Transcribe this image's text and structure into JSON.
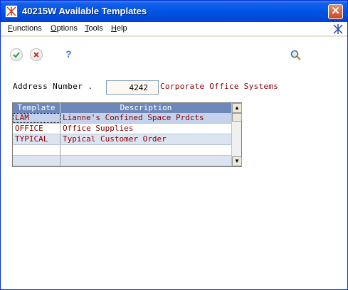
{
  "window": {
    "title": "40215W  Available Templates",
    "close_glyph": "✕"
  },
  "menu": {
    "items": [
      {
        "mnemonic": "F",
        "rest": "unctions"
      },
      {
        "mnemonic": "O",
        "rest": "ptions"
      },
      {
        "mnemonic": "T",
        "rest": "ools"
      },
      {
        "mnemonic": "H",
        "rest": "elp"
      }
    ]
  },
  "toolbar": {
    "ok_icon": "checkmark-icon",
    "cancel_icon": "cancel-icon",
    "help_label": "?",
    "find_icon": "magnifier-icon",
    "accent_ok": "#2a9a2a",
    "accent_cancel": "#d03020"
  },
  "form": {
    "address_label": "Address Number .",
    "address_value": "4242",
    "address_description": "Corporate Office Systems"
  },
  "grid": {
    "headers": {
      "template": "Template",
      "description": "Description"
    },
    "rows": [
      {
        "template": "LAM",
        "description": "Lianne's Confined Space Prdcts"
      },
      {
        "template": "OFFICE",
        "description": "Office Supplies"
      },
      {
        "template": "TYPICAL",
        "description": "Typical Customer Order"
      },
      {
        "template": "",
        "description": ""
      },
      {
        "template": "",
        "description": ""
      }
    ],
    "scroll_up_glyph": "▲",
    "scroll_down_glyph": "▼"
  }
}
